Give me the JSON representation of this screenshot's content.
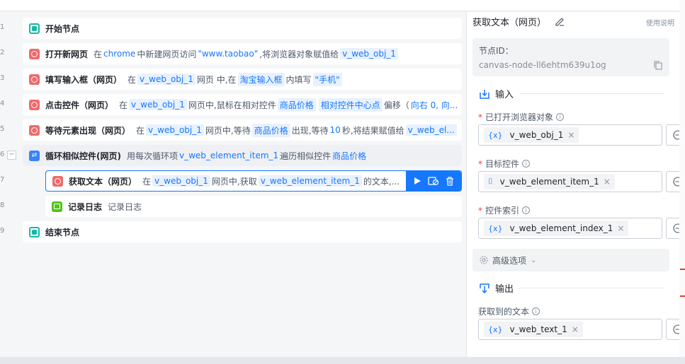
{
  "flow": {
    "rows": [
      {
        "line": "1",
        "title": "开始节点",
        "icon": "start-node-icon"
      },
      {
        "line": "2",
        "title": "打开新网页",
        "icon": "web-node-icon",
        "segments": [
          {
            "t": "在 ",
            "k": "d"
          },
          {
            "t": "chrome",
            "k": "b"
          },
          {
            "t": " 中新建网页访问 ",
            "k": "d"
          },
          {
            "t": "\"www.taobao\"",
            "k": "b"
          },
          {
            "t": ",将浏览器对象赋值给 ",
            "k": "d"
          },
          {
            "t": "v_web_obj_1",
            "k": "v"
          }
        ]
      },
      {
        "line": "3",
        "title": "填写输入框（网页）",
        "icon": "web-node-icon",
        "segments": [
          {
            "t": "在 ",
            "k": "d"
          },
          {
            "t": "v_web_obj_1",
            "k": "v"
          },
          {
            "t": " 网页 中,在 ",
            "k": "d"
          },
          {
            "t": "淘宝输入框",
            "k": "v"
          },
          {
            "t": " 内填写 ",
            "k": "d"
          },
          {
            "t": "\"手机\"",
            "k": "v"
          }
        ]
      },
      {
        "line": "4",
        "title": "点击控件（网页）",
        "icon": "web-node-icon",
        "segments": [
          {
            "t": "在 ",
            "k": "d"
          },
          {
            "t": "v_web_obj_1",
            "k": "v"
          },
          {
            "t": " 网页中,鼠标在相对控件 ",
            "k": "d"
          },
          {
            "t": "商品价格",
            "k": "v"
          },
          {
            "t": "相对控件中心点",
            "k": "v"
          },
          {
            "t": "偏移（",
            "k": "d"
          },
          {
            "t": "向右 0, 向...",
            "k": "b"
          }
        ]
      },
      {
        "line": "5",
        "title": "等待元素出现（网页）",
        "icon": "web-node-icon",
        "segments": [
          {
            "t": "在 ",
            "k": "d"
          },
          {
            "t": "v_web_obj_1",
            "k": "v"
          },
          {
            "t": " 网页中,等待 ",
            "k": "d"
          },
          {
            "t": "商品价格",
            "k": "v"
          },
          {
            "t": " 出现,等待 ",
            "k": "d"
          },
          {
            "t": "10",
            "k": "b"
          },
          {
            "t": " 秒,将结果赋值给 ",
            "k": "d"
          },
          {
            "t": "v_web_el...",
            "k": "v"
          }
        ]
      },
      {
        "line": "6",
        "title": "循环相似控件(网页)",
        "icon": "loop-node-icon",
        "segments": [
          {
            "t": "用每次循环项 ",
            "k": "d"
          },
          {
            "t": "v_web_element_item_1",
            "k": "b"
          },
          {
            "t": " 遍历相似控件 ",
            "k": "d"
          },
          {
            "t": "商品价格",
            "k": "b"
          }
        ]
      },
      {
        "line": "7",
        "title": "获取文本（网页）",
        "icon": "web-node-icon",
        "segments": [
          {
            "t": "在 ",
            "k": "d"
          },
          {
            "t": "v_web_obj_1",
            "k": "v"
          },
          {
            "t": " 网页中,获取 ",
            "k": "d"
          },
          {
            "t": "v_web_element_item_1",
            "k": "v"
          },
          {
            "t": " 的文本,...",
            "k": "d"
          }
        ]
      },
      {
        "line": "8",
        "title": "记录日志",
        "icon": "log-node-icon",
        "segments": [
          {
            "t": "记录日志",
            "k": "d"
          }
        ]
      },
      {
        "line": "9",
        "title": "结束节点",
        "icon": "end-node-icon"
      }
    ],
    "fold_symbol": "−"
  },
  "panel": {
    "title": "获取文本（网页）",
    "help": "使用说明",
    "node_id_label": "节点ID：",
    "node_id_value": "canvas-node-ll6ehtm639u1og",
    "input_section": "输入",
    "fields": [
      {
        "label": "已打开浏览器对象",
        "required": true,
        "tag_icon": "{x}",
        "value": "v_web_obj_1"
      },
      {
        "label": "目标控件",
        "required": true,
        "tag_icon": "⌷",
        "value": "v_web_element_item_1"
      },
      {
        "label": "控件索引",
        "required": true,
        "tag_icon": "{x}",
        "value": "v_web_element_index_1"
      }
    ],
    "advanced": "高级选项",
    "output_section": "输出",
    "output_field": {
      "label": "获取到的文本",
      "tag_icon": "{x}",
      "value": "v_web_text_1"
    }
  }
}
